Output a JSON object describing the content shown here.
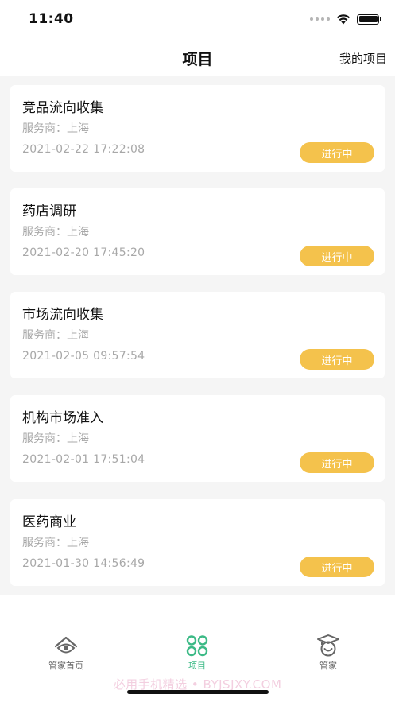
{
  "status_bar": {
    "time": "11:40"
  },
  "nav": {
    "title": "项目",
    "right_action": "我的项目"
  },
  "projects": [
    {
      "title": "竞品流向收集",
      "provider": "服务商：上海",
      "time": "2021-02-22 17:22:08",
      "status": "进行中"
    },
    {
      "title": "药店调研",
      "provider": "服务商：上海",
      "time": "2021-02-20 17:45:20",
      "status": "进行中"
    },
    {
      "title": "市场流向收集",
      "provider": "服务商：上海",
      "time": "2021-02-05 09:57:54",
      "status": "进行中"
    },
    {
      "title": "机构市场准入",
      "provider": "服务商：上海",
      "time": "2021-02-01 17:51:04",
      "status": "进行中"
    },
    {
      "title": "医药商业",
      "provider": "服务商：上海",
      "time": "2021-01-30 14:56:49",
      "status": "进行中"
    }
  ],
  "tabs": [
    {
      "label": "管家首页",
      "icon": "eye-house-icon",
      "active": false
    },
    {
      "label": "项目",
      "icon": "four-circles-icon",
      "active": true
    },
    {
      "label": "管家",
      "icon": "graduation-cap-face-icon",
      "active": false
    }
  ],
  "colors": {
    "accent": "#3cba86",
    "badge": "#f4c24c",
    "background": "#f5f5f5",
    "muted_text": "#a8a8a8"
  },
  "watermark": "必用手机精选 • BYJSJXY.COM"
}
